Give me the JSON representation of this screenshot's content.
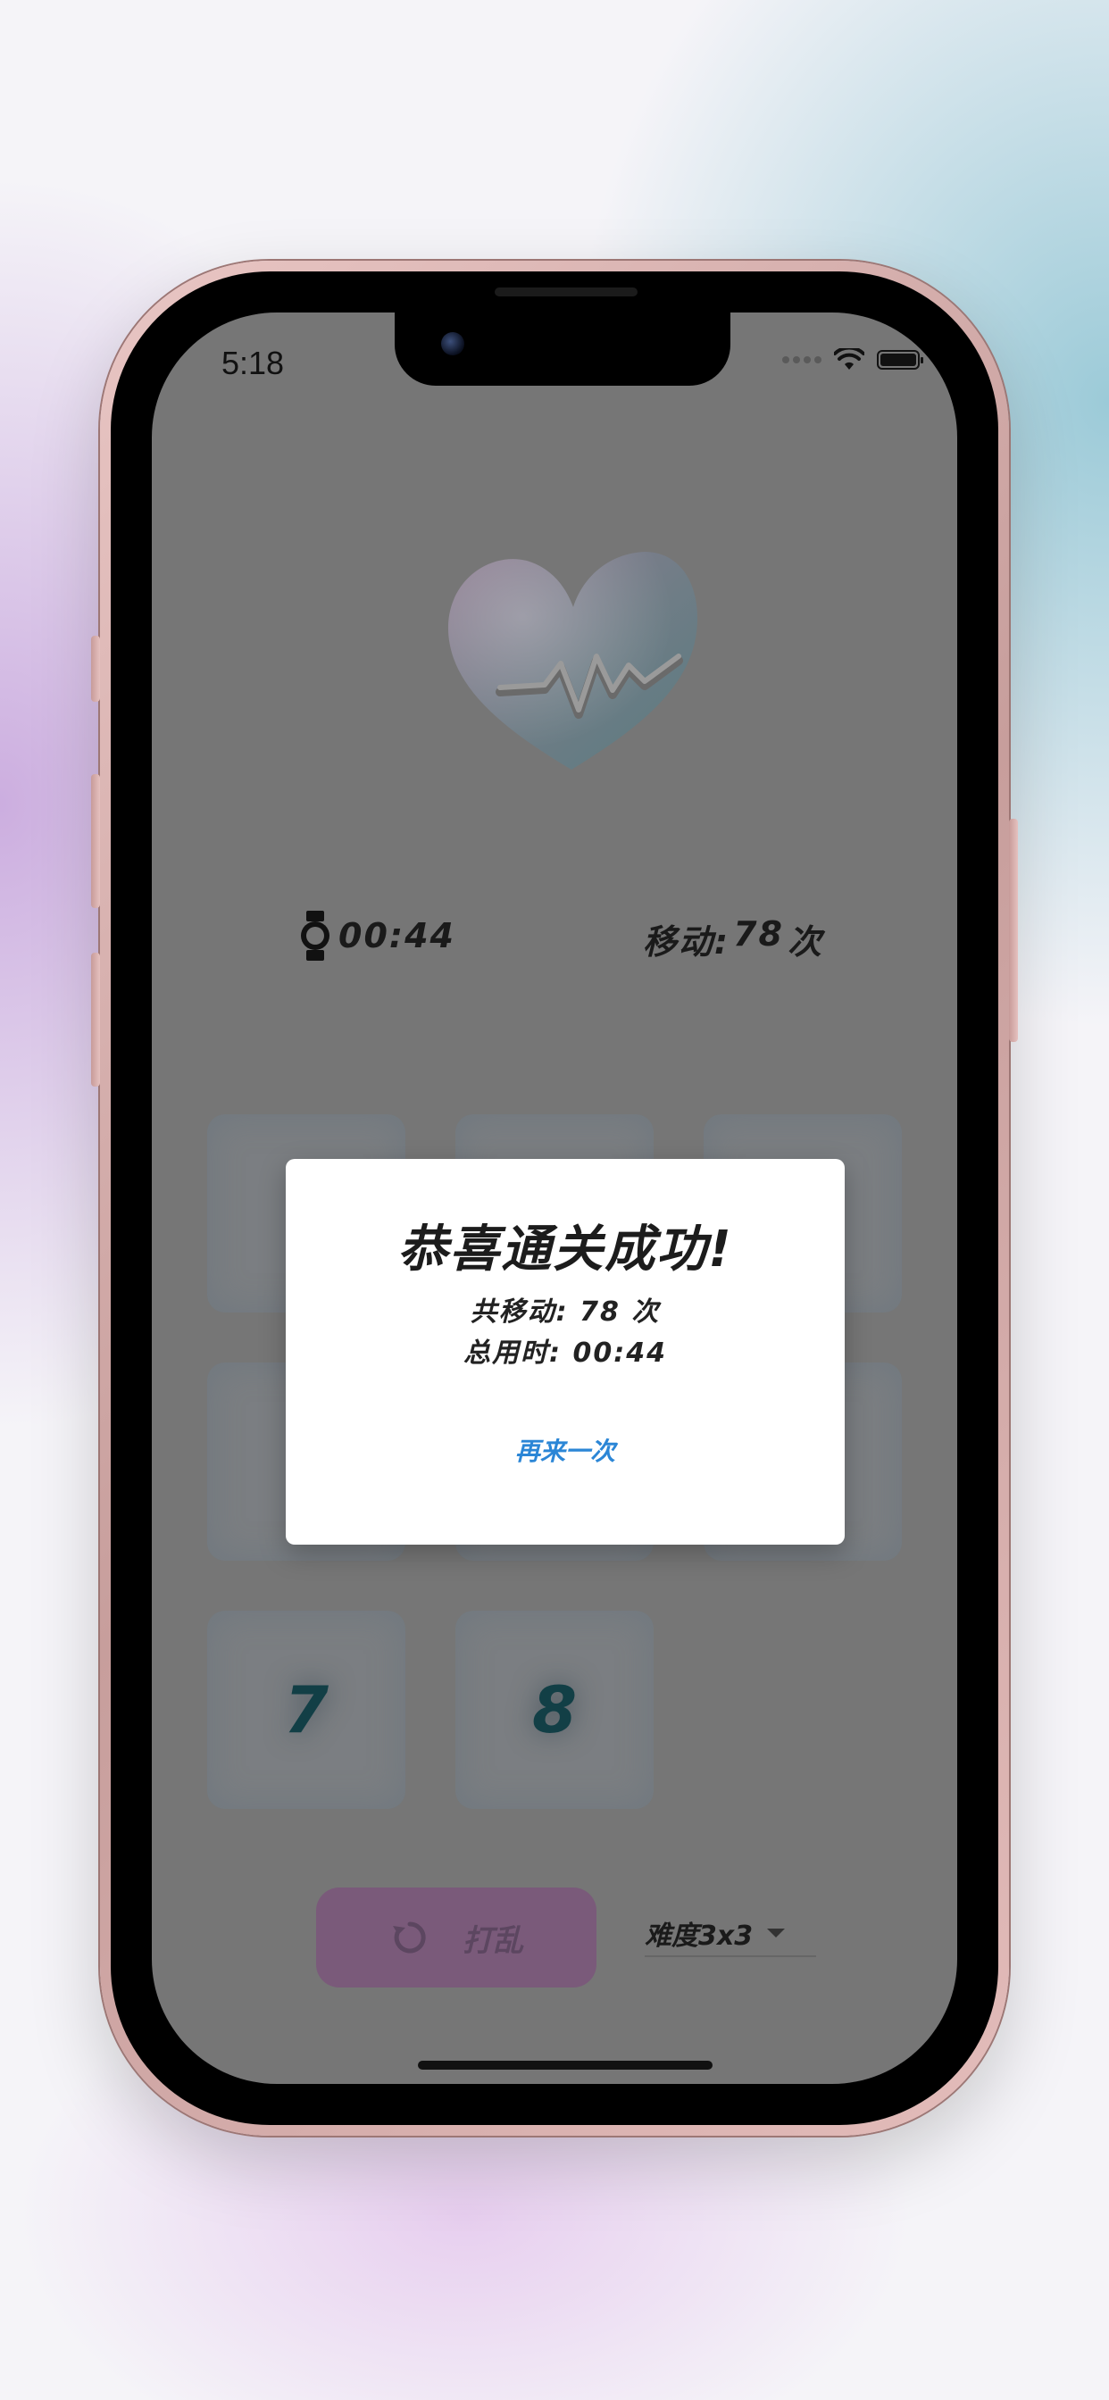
{
  "status_bar": {
    "time": "5:18",
    "icons": [
      "signal-dots-icon",
      "wifi-icon",
      "battery-icon"
    ]
  },
  "game": {
    "timer_icon": "watch-icon",
    "time": "00:44",
    "moves_label": "移动:",
    "moves_value": "78",
    "moves_unit": "次",
    "tiles": [
      {
        "value": "",
        "state": "covered"
      },
      {
        "value": "",
        "state": "covered"
      },
      {
        "value": "",
        "state": "covered"
      },
      {
        "value": "",
        "state": "covered"
      },
      {
        "value": "",
        "state": "covered"
      },
      {
        "value": "",
        "state": "covered"
      },
      {
        "value": "7",
        "state": "visible"
      },
      {
        "value": "8",
        "state": "visible"
      },
      {
        "value": "",
        "state": "empty"
      }
    ],
    "tile_text_color": "#123f46"
  },
  "controls": {
    "shuffle_icon": "refresh-icon",
    "shuffle_label": "打乱",
    "difficulty_label": "难度3x3",
    "accent_color": "#7a5a7a"
  },
  "dialog": {
    "title": "恭喜通关成功!",
    "moves_line": "共移动: 78 次",
    "time_line": "总用时: 00:44",
    "action_label": "再来一次",
    "action_color": "#2b86d6"
  }
}
